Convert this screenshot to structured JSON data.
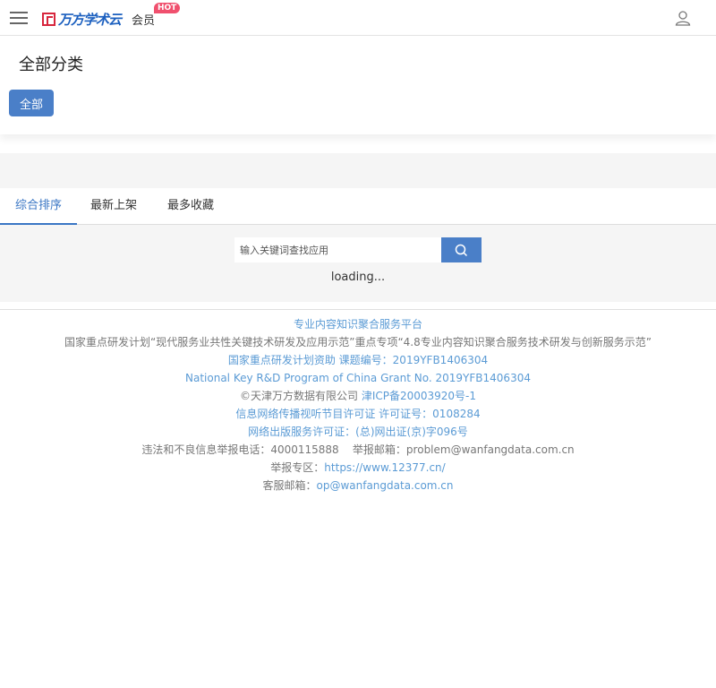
{
  "header": {
    "logo_text": "万方学术云",
    "member_label": "会员",
    "hot_badge": "HOT"
  },
  "category": {
    "title": "全部分类",
    "all_button": "全部"
  },
  "tabs": [
    {
      "label": "综合排序"
    },
    {
      "label": "最新上架"
    },
    {
      "label": "最多收藏"
    }
  ],
  "search": {
    "placeholder": "输入关键词查找应用"
  },
  "status": {
    "loading": "loading..."
  },
  "footer": {
    "platform": "专业内容知识聚合服务平台",
    "project": "国家重点研发计划“现代服务业共性关键技术研发及应用示范”重点专项“4.8专业内容知识聚合服务技术研发与创新服务示范”",
    "grant_cn": "国家重点研发计划资助 课题编号：2019YFB1406304",
    "grant_en": "National Key R&D Program of China Grant No. 2019YFB1406304",
    "copyright": "©天津万方数据有限公司 ",
    "icp": "津ICP备20003920号-1",
    "av_license": "信息网络传播视听节目许可证 许可证号：0108284",
    "publish_license": "网络出版服务许可证：(总)网出证(京)字096号",
    "report_phone": "违法和不良信息举报电话：4000115888    举报邮箱：problem@wanfangdata.com.cn",
    "report_zone_label": "举报专区：",
    "report_zone_url": "https://www.12377.cn/",
    "service_label": "客服邮箱：",
    "service_email": "op@wanfangdata.com.cn"
  },
  "colors": {
    "accent": "#4a7fc8",
    "link": "#5b9bd5",
    "logo_red": "#d7263d",
    "hot": "#f0506e"
  }
}
